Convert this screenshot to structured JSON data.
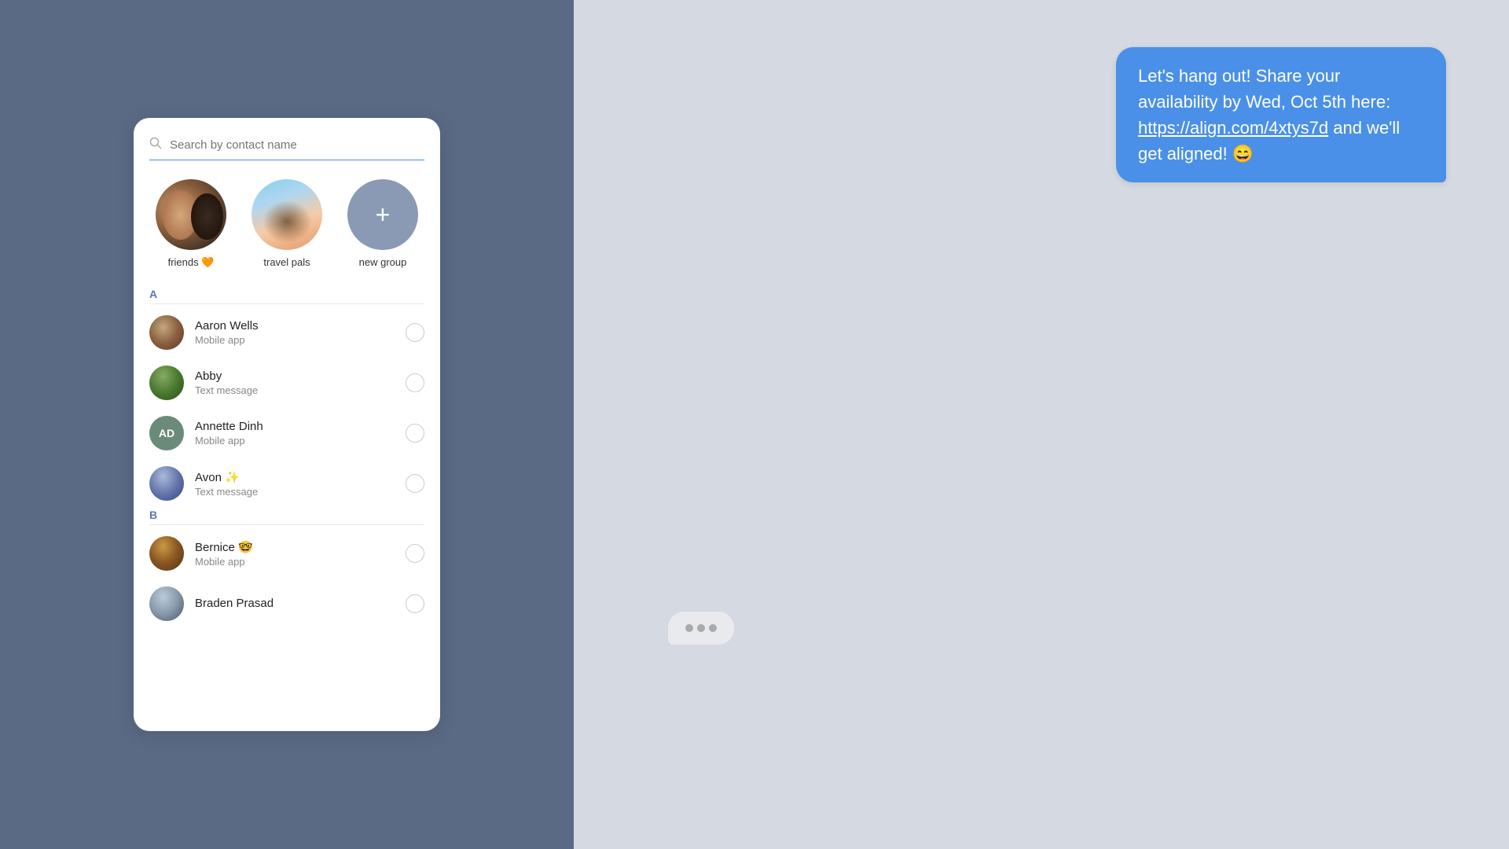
{
  "search": {
    "placeholder": "Search by contact name"
  },
  "groups": [
    {
      "id": "friends",
      "label": "friends 🧡",
      "type": "photo"
    },
    {
      "id": "travel-pals",
      "label": "travel pals",
      "type": "photo"
    },
    {
      "id": "new-group",
      "label": "new group",
      "type": "new"
    }
  ],
  "sections": [
    {
      "letter": "A",
      "contacts": [
        {
          "id": "aaron-wells",
          "name": "Aaron Wells",
          "sub": "Mobile app",
          "avatarType": "photo",
          "avatarClass": "photo-aaron"
        },
        {
          "id": "abby",
          "name": "Abby",
          "sub": "Text message",
          "avatarType": "photo",
          "avatarClass": "photo-abby"
        },
        {
          "id": "annette-dinh",
          "name": "Annette Dinh",
          "sub": "Mobile app",
          "avatarType": "initials",
          "initials": "AD",
          "initialsColor": "#6a8a7a"
        },
        {
          "id": "avon",
          "name": "Avon ✨",
          "sub": "Text message",
          "avatarType": "photo",
          "avatarClass": "photo-avon"
        }
      ]
    },
    {
      "letter": "B",
      "contacts": [
        {
          "id": "bernice",
          "name": "Bernice 🤓",
          "sub": "Mobile app",
          "avatarType": "photo",
          "avatarClass": "photo-bernice"
        },
        {
          "id": "braden-prasad",
          "name": "Braden Prasad",
          "sub": "",
          "avatarType": "photo",
          "avatarClass": "photo-braden"
        }
      ]
    }
  ],
  "message": {
    "text_part1": "Let's hang out! Share your availability by Wed, Oct 5th here: ",
    "link": "https://align.com/4xtys7d",
    "text_part2": " and we'll get aligned! 😄"
  },
  "icons": {
    "search": "🔍",
    "plus": "+"
  }
}
